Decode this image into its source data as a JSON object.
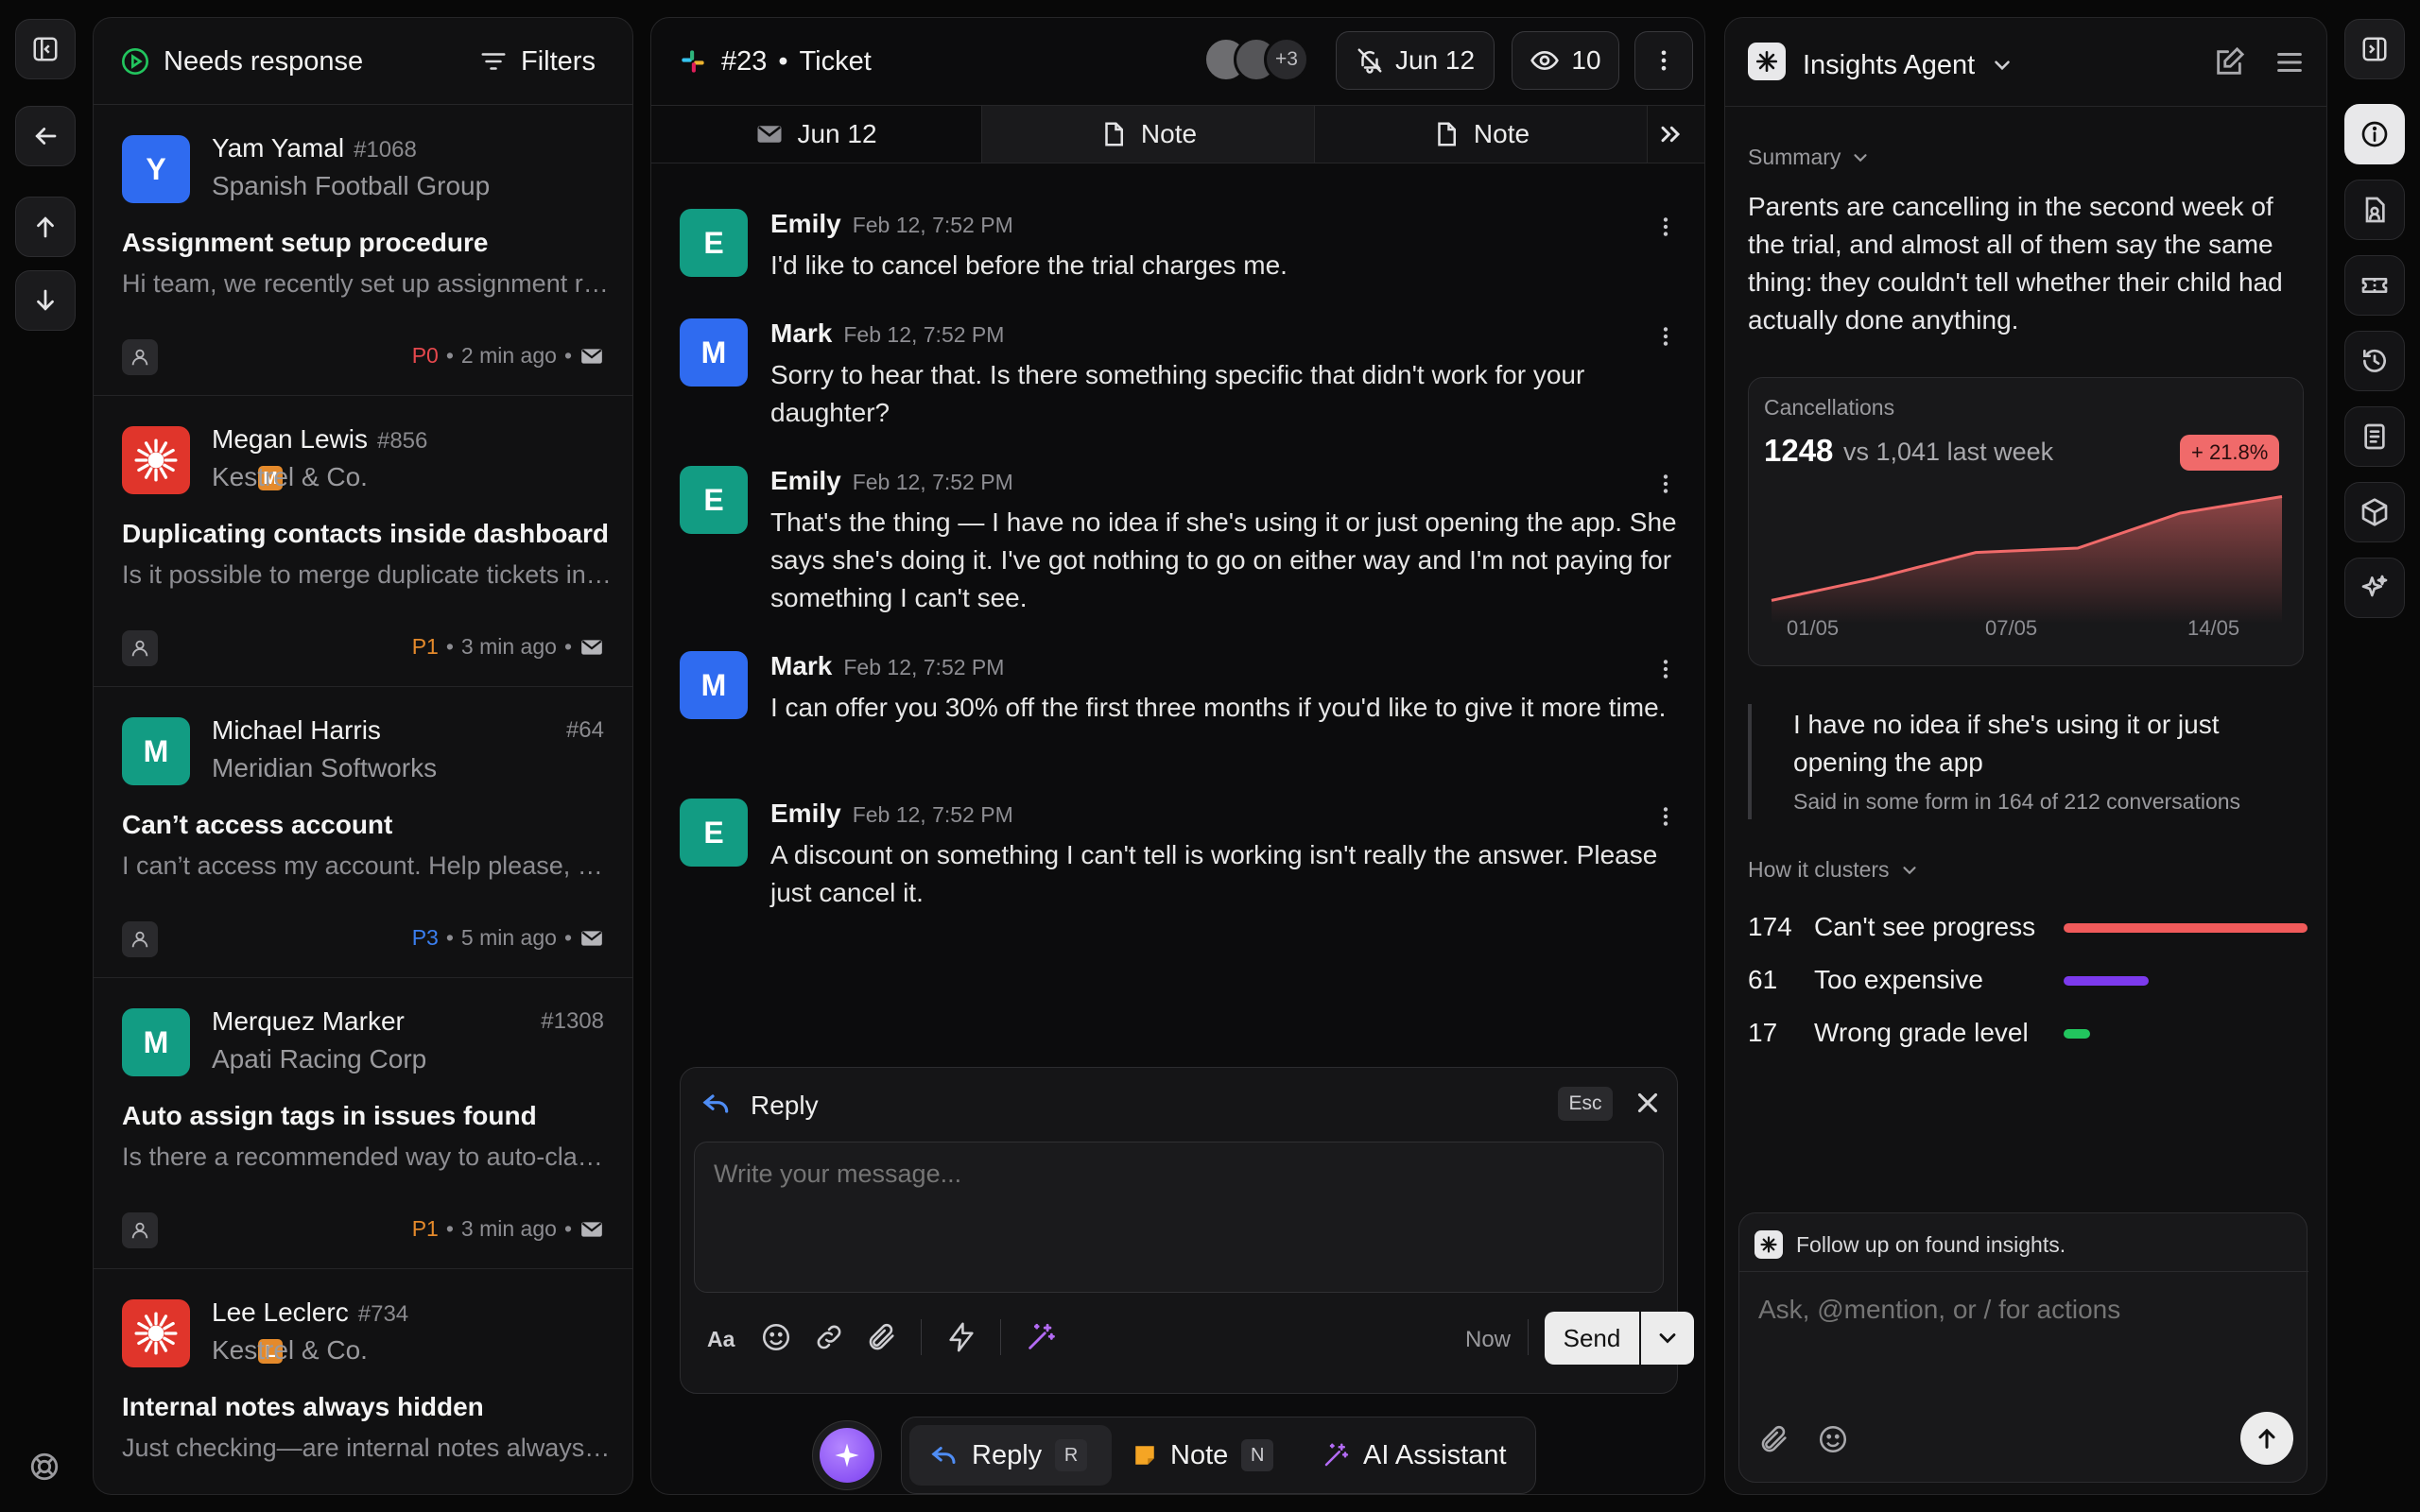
{
  "inbox": {
    "title": "Needs response",
    "filters_label": "Filters",
    "tickets": [
      {
        "name": "Yam Yamal",
        "number": "#1068",
        "company": "Spanish Football Group",
        "subject": "Assignment setup procedure",
        "preview": "Hi team, we recently set up assignment rules for our team",
        "priority": "P0",
        "time": "2 min ago",
        "avatar_letter": "Y",
        "avatar_color": "#2f6bf0",
        "priority_color": "#e5484d"
      },
      {
        "name": "Megan Lewis",
        "number": "#856",
        "company": "Kestrel & Co.",
        "subject": "Duplicating contacts inside dashboard",
        "preview": "Is it possible to merge duplicate tickets in the dashboard?",
        "priority": "P1",
        "time": "3 min ago",
        "avatar_letter": "M",
        "avatar_color": "#e0352b",
        "priority_color": "#e58a2b"
      },
      {
        "name": "Michael Harris",
        "number": "#64",
        "company": "Meridian Softworks",
        "subject": "Can’t access account",
        "preview": "I can’t access my account. Help please, as soon as possible",
        "priority": "P3",
        "time": "5 min ago",
        "avatar_letter": "M",
        "avatar_color": "#129c83",
        "priority_color": "#3b7ff0"
      },
      {
        "name": "Merquez Marker",
        "number": "#1308",
        "company": "Apati Racing Corp",
        "subject": "Auto assign tags in issues found",
        "preview": "Is there a recommended way to auto-classify these issues?",
        "priority": "P1",
        "time": "3 min ago",
        "avatar_letter": "M",
        "avatar_color": "#129c83",
        "priority_color": "#e58a2b"
      },
      {
        "name": "Lee Leclerc",
        "number": "#734",
        "company": "Kestrel & Co.",
        "subject": "Internal notes always hidden",
        "preview": "Just checking—are internal notes always hidden from customers?",
        "priority": "",
        "time": "",
        "avatar_letter": "L",
        "avatar_color": "#e0352b",
        "priority_color": "#e58a2b"
      }
    ]
  },
  "ticket": {
    "channel_number": "#23",
    "separator": "•",
    "label": "Ticket",
    "participants_extra": "+3",
    "snooze_date": "Jun 12",
    "viewers": "10",
    "tabs": [
      {
        "label": "Jun 12",
        "icon": "mail-icon"
      },
      {
        "label": "Note",
        "icon": "note-icon"
      },
      {
        "label": "Note",
        "icon": "note-icon"
      }
    ],
    "messages": [
      {
        "author": "Emily",
        "time": "Feb 12, 7:52 PM",
        "text": "I'd like to cancel before the trial charges me.",
        "letter": "E",
        "color": "#129c83"
      },
      {
        "author": "Mark",
        "time": "Feb 12, 7:52 PM",
        "text": "Sorry to hear that. Is there something specific that didn't work for your daughter?",
        "letter": "M",
        "color": "#2f6bf0"
      },
      {
        "author": "Emily",
        "time": "Feb 12, 7:52 PM",
        "text": "That's the thing — I have no idea if she's using it or just opening the app. She says she's doing it. I've got nothing to go on either way and I'm not paying for something I can't see.",
        "letter": "E",
        "color": "#129c83"
      },
      {
        "author": "Mark",
        "time": "Feb 12, 7:52 PM",
        "text": "I can offer you 30% off the first three months if you'd like to give it more time.",
        "letter": "M",
        "color": "#2f6bf0"
      },
      {
        "author": "Emily",
        "time": "Feb 12, 7:52 PM",
        "text": "A discount on something I can't tell is working isn't really the answer. Please just cancel it.",
        "letter": "E",
        "color": "#129c83"
      }
    ],
    "reply": {
      "title": "Reply",
      "esc": "Esc",
      "placeholder": "Write your message...",
      "now": "Now",
      "send": "Send",
      "format_label": "Aa"
    },
    "bottom_bar": [
      {
        "label": "Reply",
        "key": "R"
      },
      {
        "label": "Note",
        "key": "N"
      },
      {
        "label": "AI Assistant",
        "key": ""
      }
    ]
  },
  "insights": {
    "title": "Insights Agent",
    "summary_label": "Summary",
    "summary_text": "Parents are cancelling in the second week of the trial, and almost all of them say the same thing: they couldn't tell whether their child had actually done anything.",
    "card_title": "Cancellations",
    "big_value": "1248",
    "comparison": "vs 1,041 last week",
    "change": "+ 21.8%",
    "quote": "I have no idea if she's using it or just opening the app",
    "quote_source": "Said in some form in 164 of 212 conversations",
    "clusters_label": "How it clusters",
    "clusters": [
      {
        "count": "174",
        "label": "Can't see progress",
        "color": "#f05a5a",
        "fraction": 1.0
      },
      {
        "count": "61",
        "label": "Too expensive",
        "color": "#7c3aed",
        "fraction": 0.35
      },
      {
        "count": "17",
        "label": "Wrong grade level",
        "color": "#22c55e",
        "fraction": 0.1
      }
    ],
    "followup": "Follow up on found insights.",
    "ask_placeholder": "Ask, @mention, or / for actions"
  },
  "chart_data": {
    "type": "area",
    "title": "Cancellations",
    "x_ticks": [
      "01/05",
      "07/05",
      "14/05"
    ],
    "values": [
      1010,
      1060,
      1120,
      1130,
      1210,
      1248
    ],
    "color": "#f06a6a"
  }
}
